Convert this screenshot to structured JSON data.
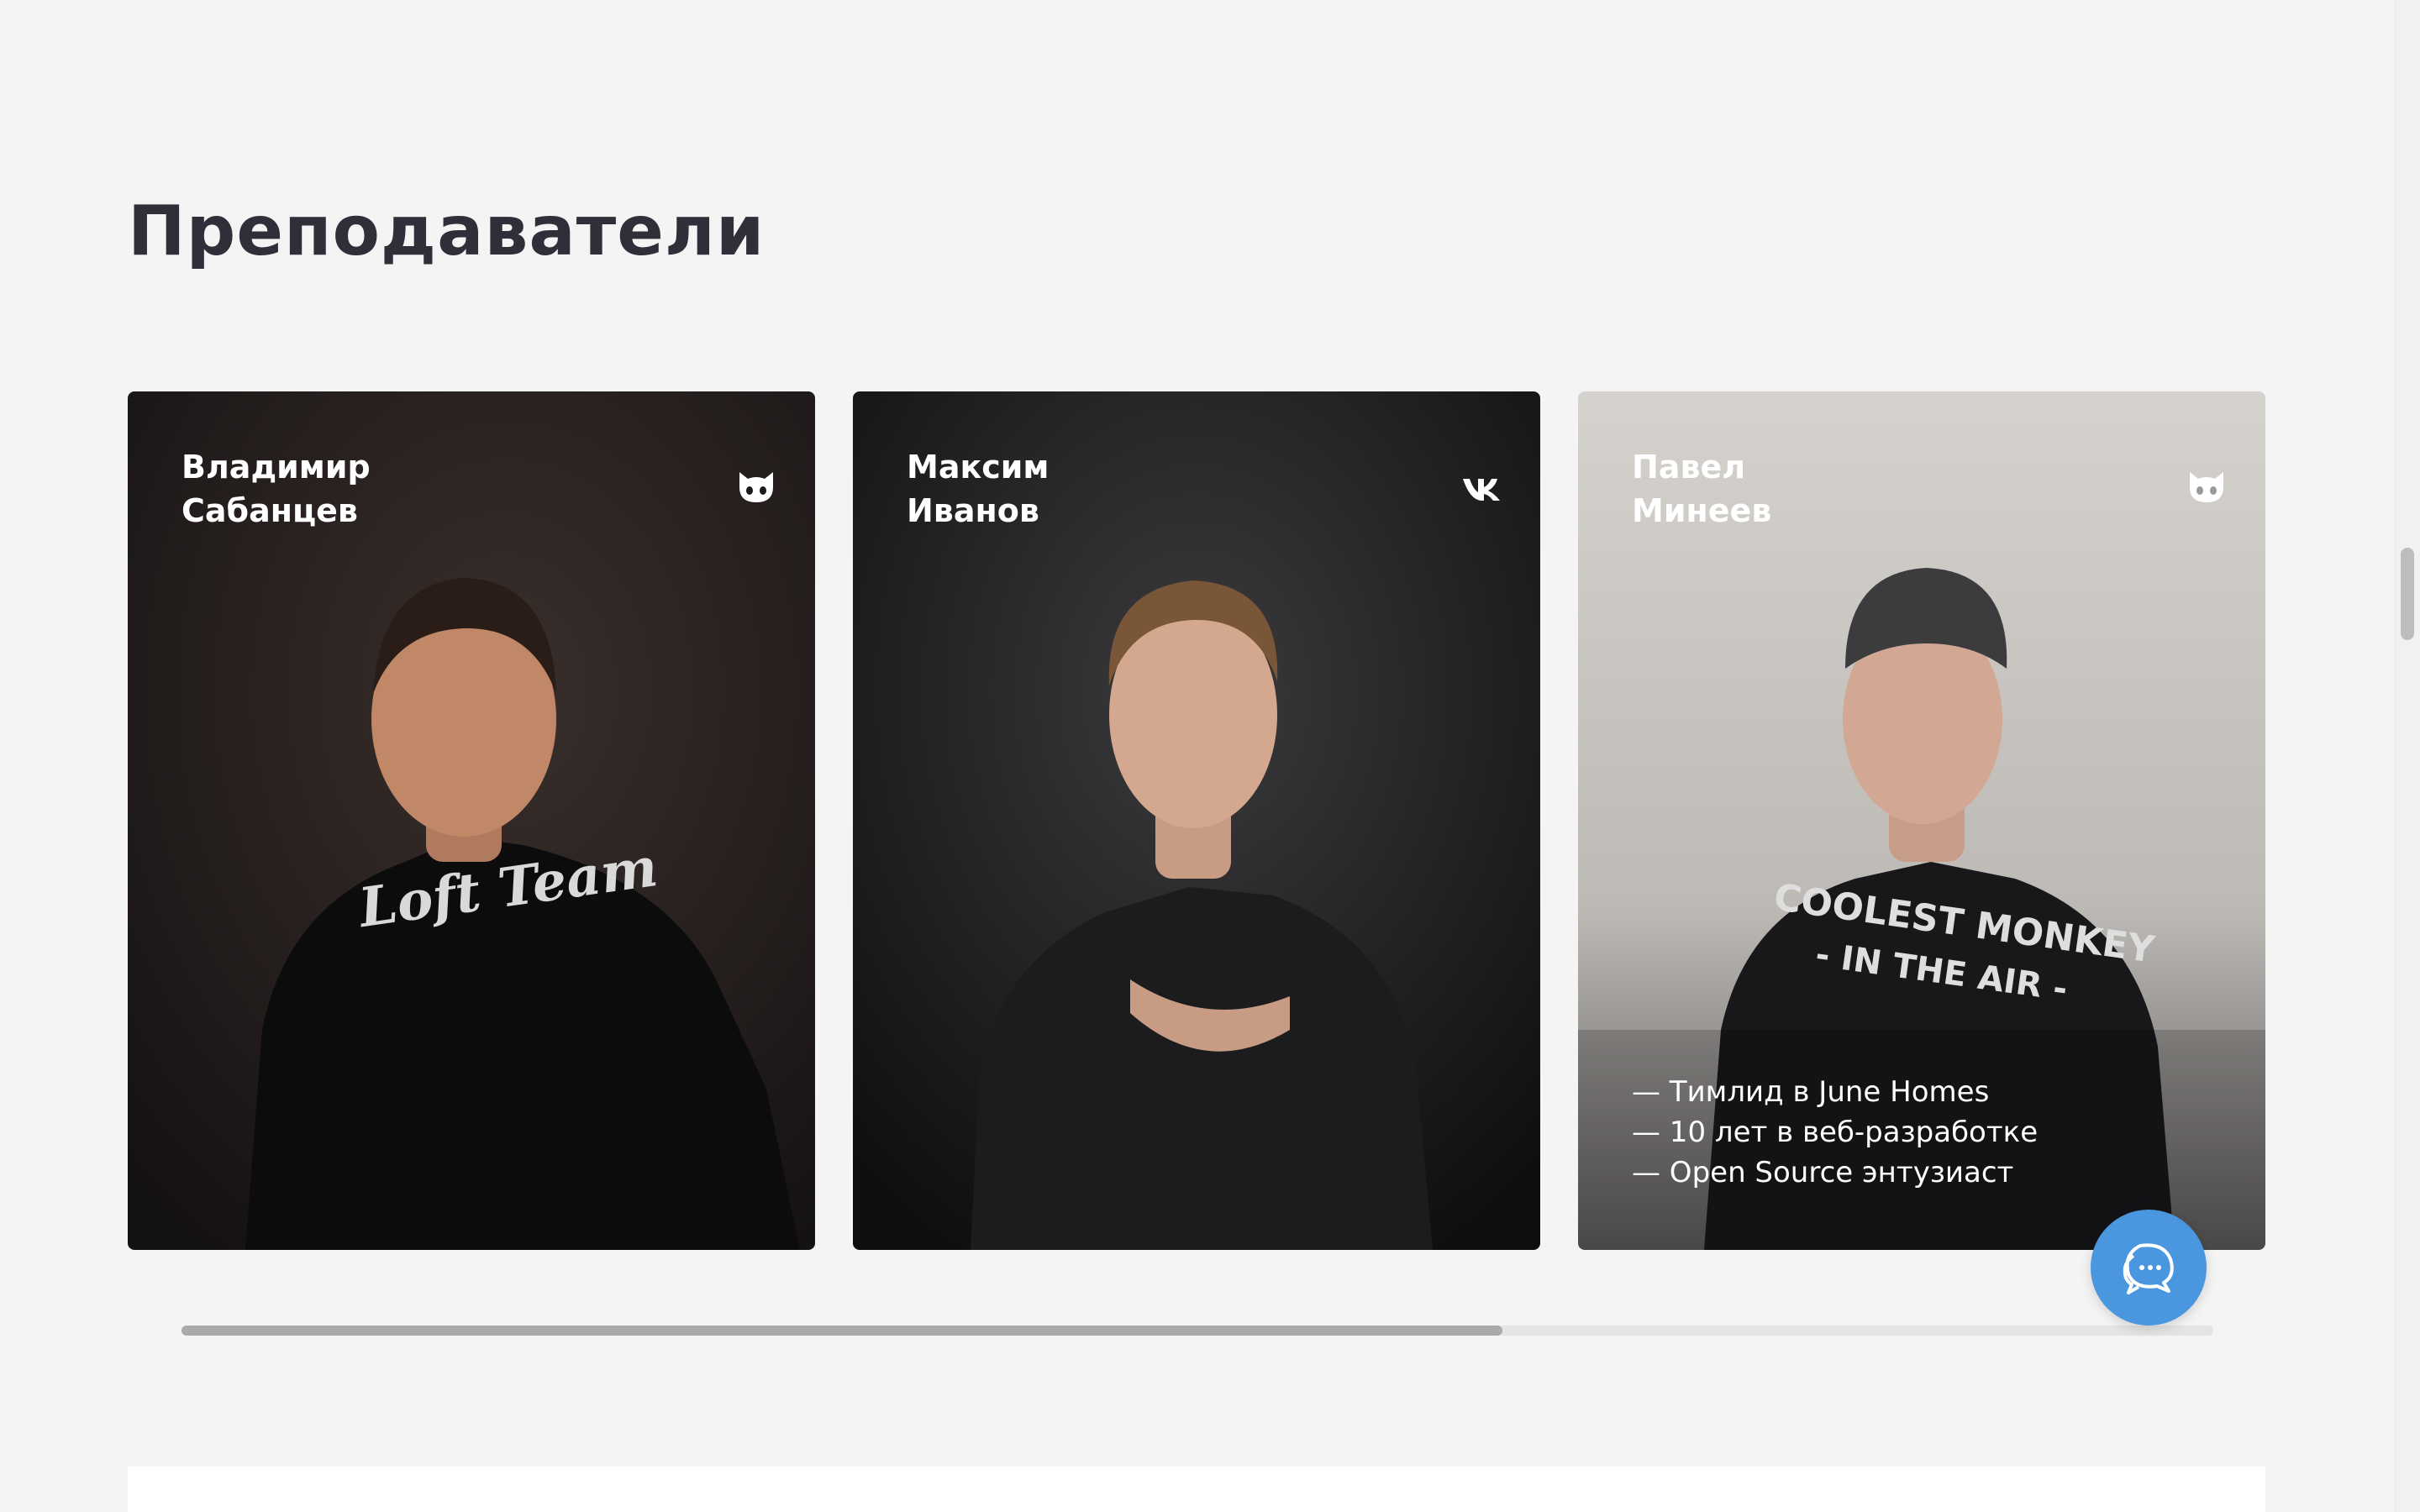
{
  "section": {
    "title": "Преподаватели"
  },
  "teachers": [
    {
      "first_name": "Владимир",
      "last_name": "Сабанцев",
      "social": "github-icon",
      "facts": []
    },
    {
      "first_name": "Максим",
      "last_name": "Иванов",
      "social": "vk-icon",
      "facts": []
    },
    {
      "first_name": "Павел",
      "last_name": "Минеев",
      "social": "github-icon",
      "facts": [
        "— Тимлид в June Homes",
        "— 10 лет в веб-разработке",
        "— Open Source энтузиаст"
      ]
    }
  ],
  "carousel": {
    "scroll_progress": 0.65
  },
  "chat": {
    "icon": "chat-bubbles-icon",
    "color": "#4a97e0"
  },
  "colors": {
    "background": "#f4f4f4",
    "title": "#2f2f3a",
    "text_on_photo": "#ffffff"
  }
}
